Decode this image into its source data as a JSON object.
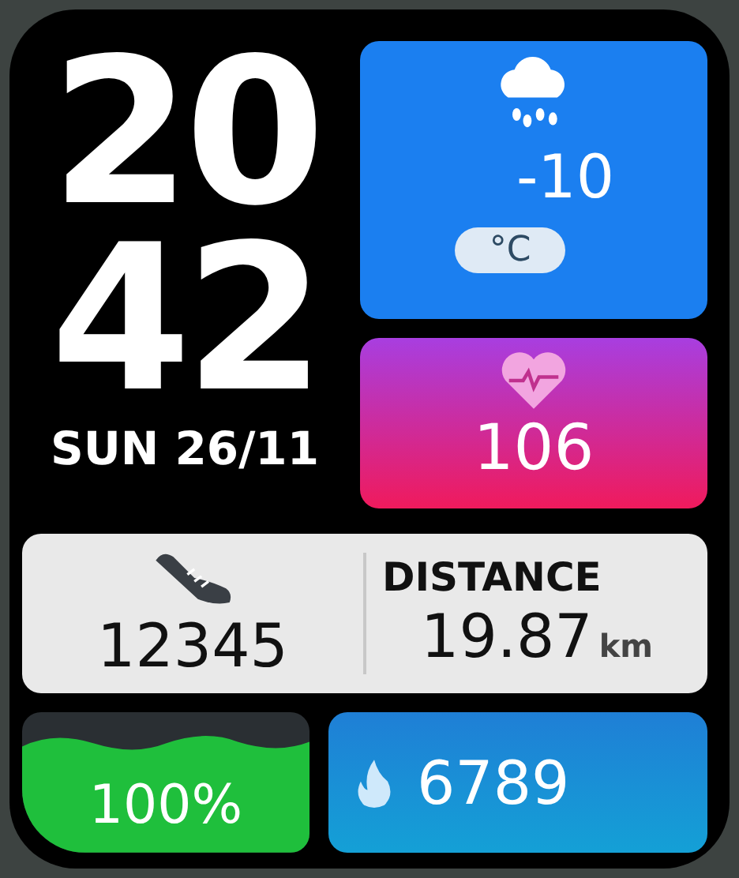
{
  "time": {
    "hours": "20",
    "minutes": "42",
    "date": "SUN 26/11"
  },
  "weather": {
    "temperature": "-10",
    "unit": "°C"
  },
  "heart_rate": {
    "value": "106"
  },
  "steps": {
    "value": "12345"
  },
  "distance": {
    "label": "DISTANCE",
    "value": "19.87",
    "unit": "km"
  },
  "battery": {
    "value": "100%"
  },
  "calories": {
    "value": "6789"
  }
}
